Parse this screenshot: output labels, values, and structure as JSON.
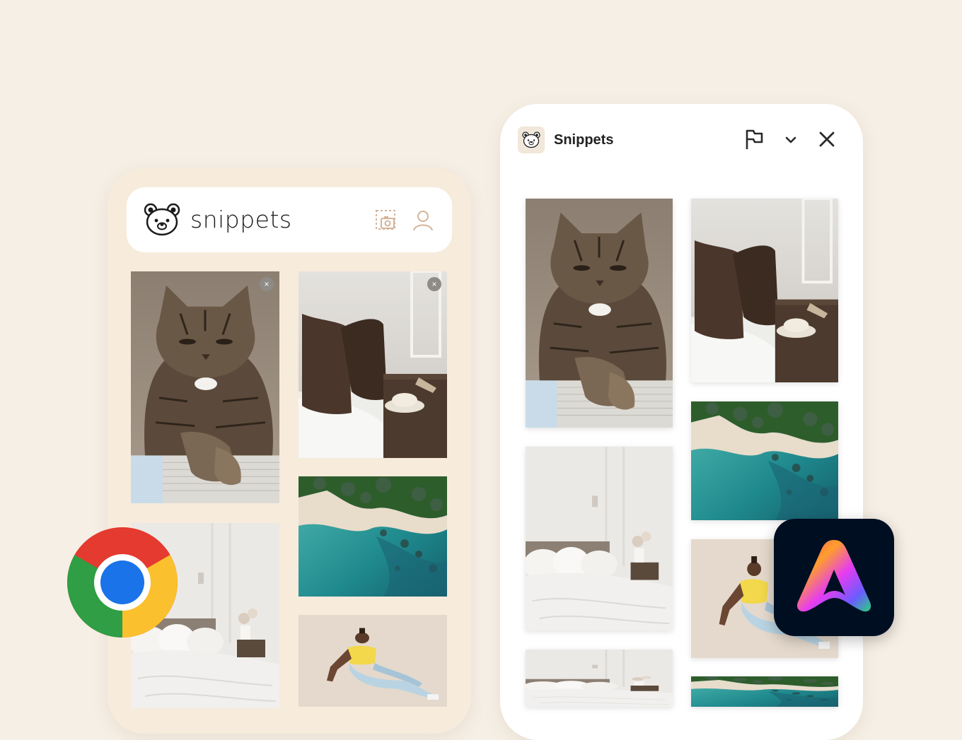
{
  "extension_popup": {
    "brand": "snippets",
    "header_icons": [
      "bear-logo-icon",
      "screenshot-capture-icon",
      "user-profile-icon"
    ],
    "close_label": "×",
    "cards": [
      {
        "subject": "tabby-cat"
      },
      {
        "subject": "bedroom-pillows"
      },
      {
        "subject": "aerial-coast"
      },
      {
        "subject": "white-bedroom"
      },
      {
        "subject": "woman-sand"
      }
    ]
  },
  "side_panel": {
    "title": "Snippets",
    "header_icons": [
      "bear-logo-icon",
      "flag-icon",
      "chevron-down-icon",
      "close-icon"
    ],
    "cards": [
      {
        "subject": "tabby-cat"
      },
      {
        "subject": "bedroom-pillows"
      },
      {
        "subject": "aerial-coast"
      },
      {
        "subject": "white-bedroom"
      },
      {
        "subject": "woman-sand"
      },
      {
        "subject": "white-bedroom"
      },
      {
        "subject": "aerial-coast"
      }
    ]
  },
  "app_icons": [
    "chrome-logo-icon",
    "adobe-express-logo-icon"
  ],
  "colors": {
    "background": "#f6efe5",
    "popup_frame": "#f7ebdc",
    "panel_frame": "#ffffff",
    "adobe_tile": "#000e22"
  }
}
